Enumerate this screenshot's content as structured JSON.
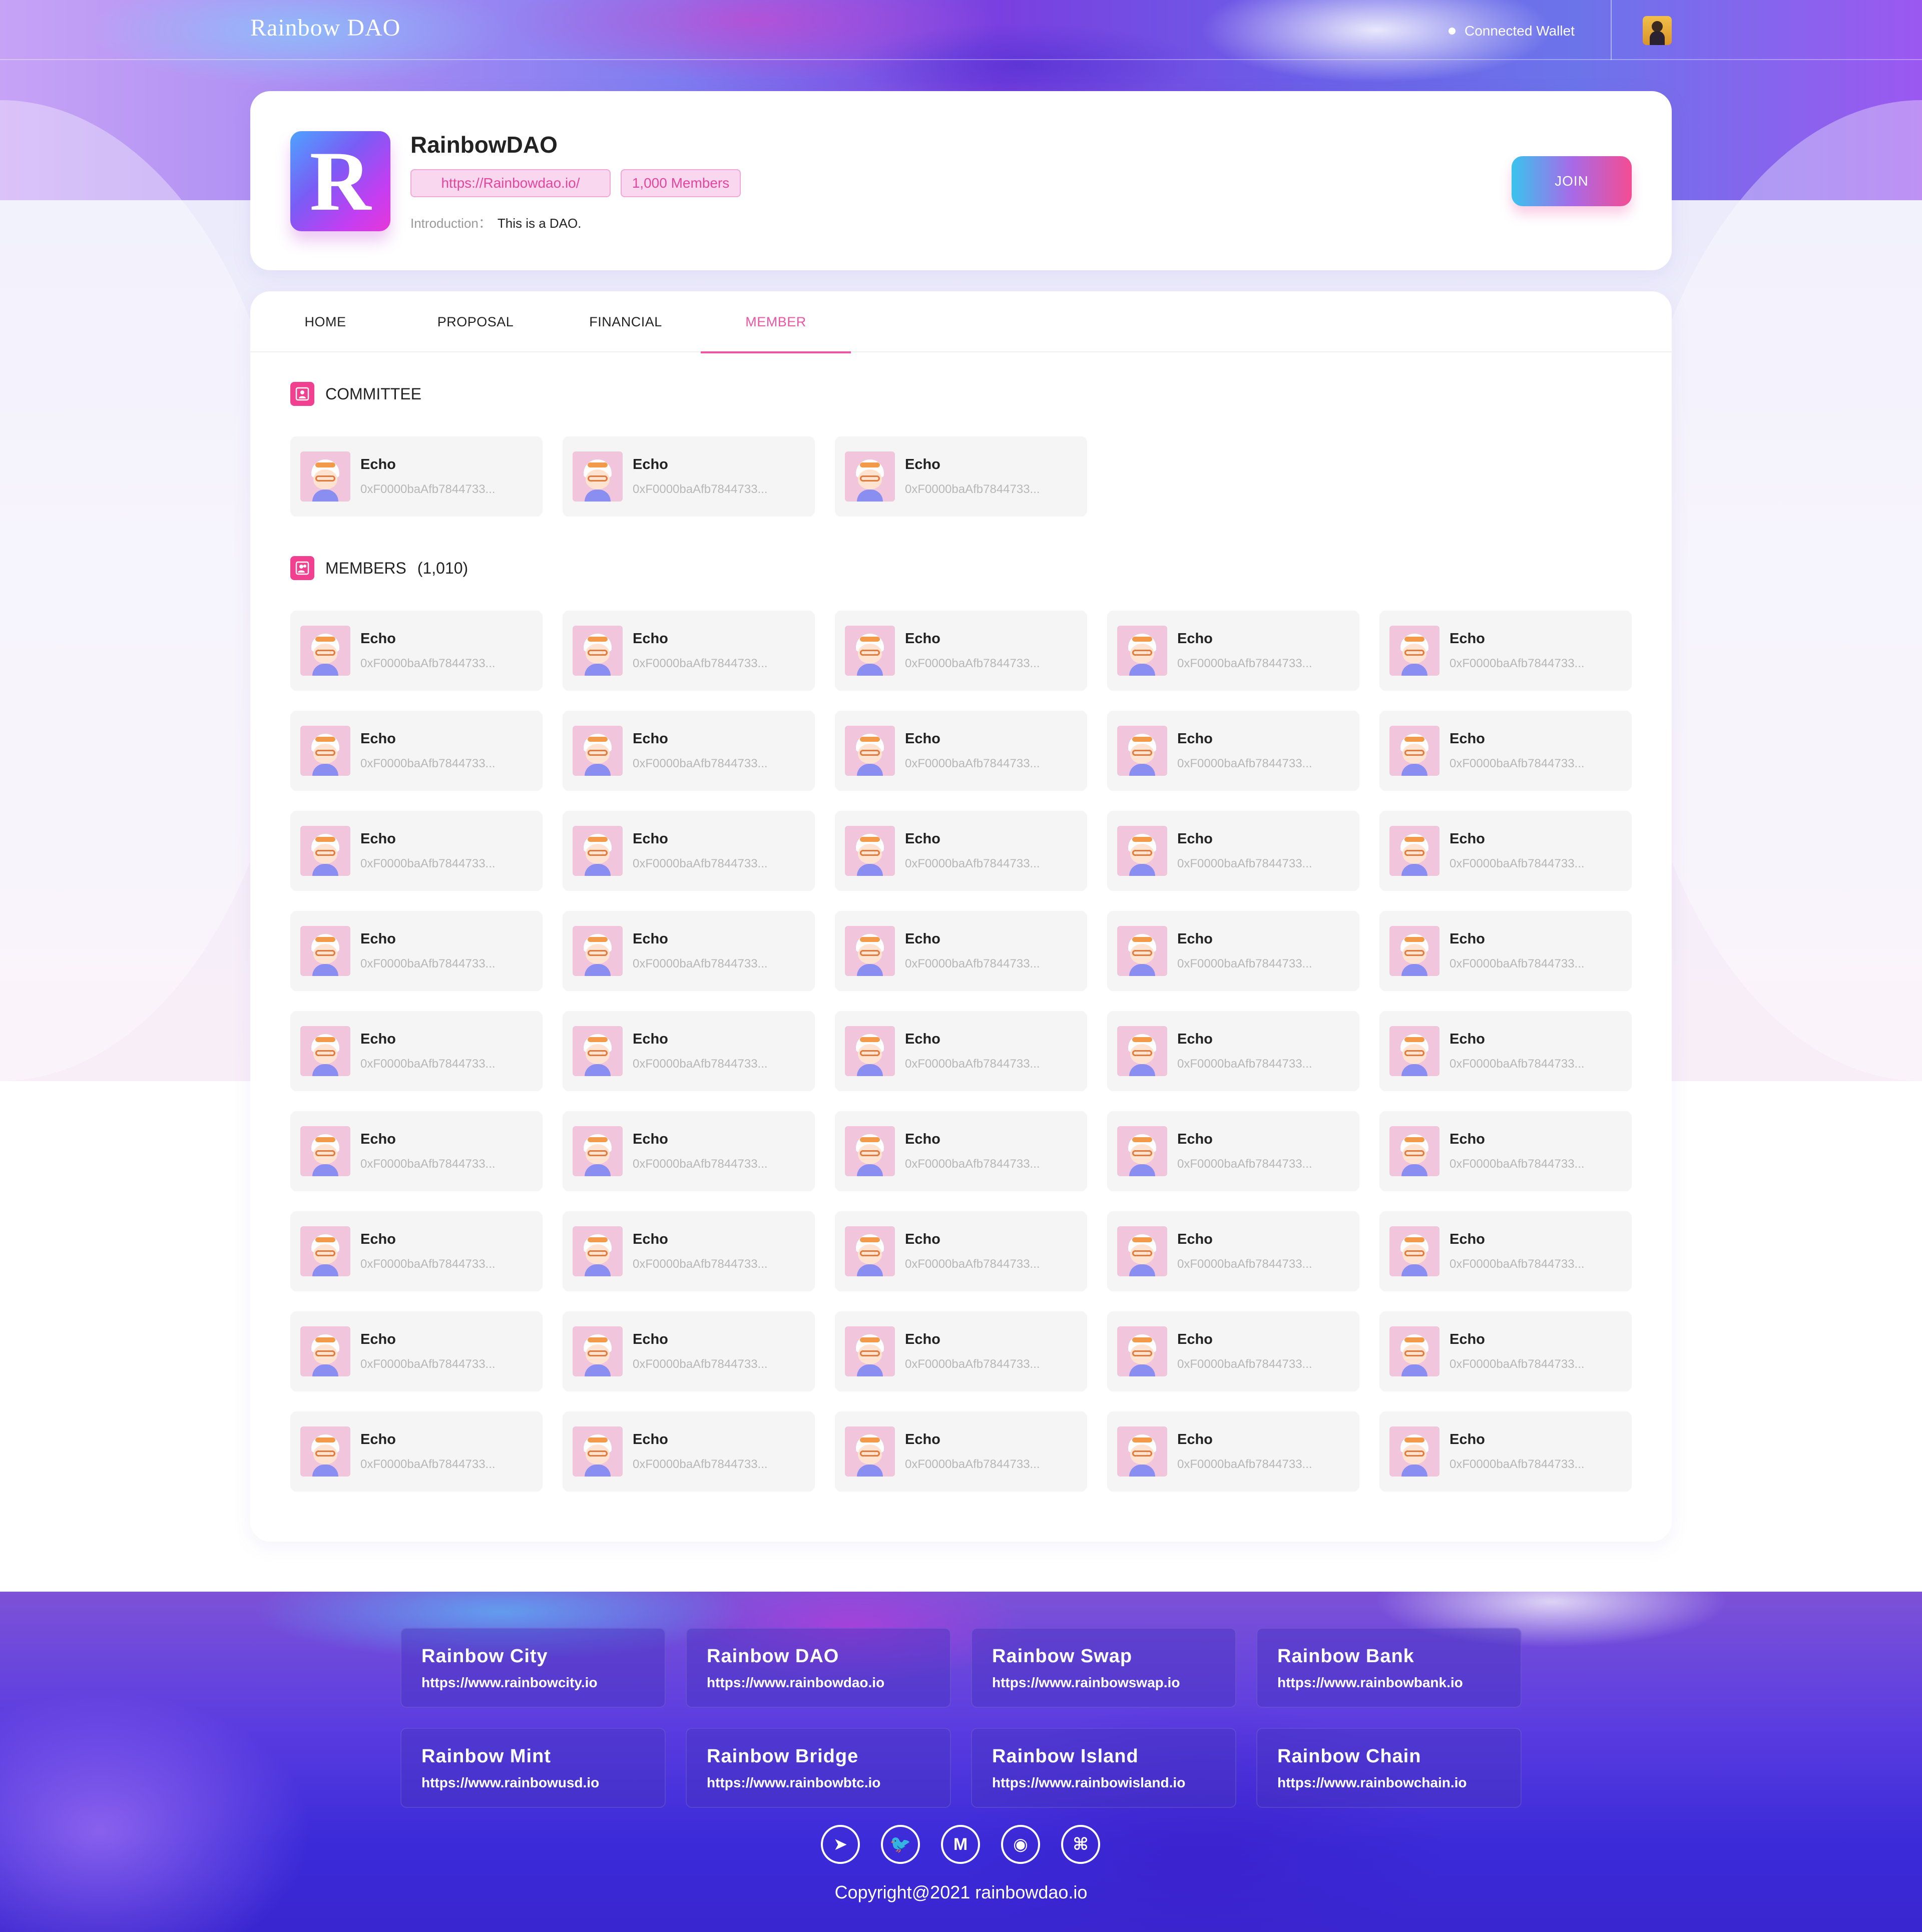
{
  "header": {
    "logo": "Rainbow DAO",
    "wallet_label": "Connected  Wallet",
    "avatar_icon": "user-avatar-icon"
  },
  "profile": {
    "logo_letter": "R",
    "name": "RainbowDAO",
    "url": "https://Rainbowdao.io/",
    "members_count": "1,000 Members",
    "intro_label": "Introduction：",
    "intro_value": "This is a DAO.",
    "join_label": "JOIN"
  },
  "tabs": [
    {
      "label": "HOME",
      "active": false
    },
    {
      "label": "PROPOSAL",
      "active": false
    },
    {
      "label": "FINANCIAL",
      "active": false
    },
    {
      "label": "MEMBER",
      "active": true
    }
  ],
  "committee": {
    "title": "COMMITTEE",
    "icon": "committee-icon",
    "members": [
      {
        "name": "Echo",
        "address": "0xF0000baAfb7844733..."
      },
      {
        "name": "Echo",
        "address": "0xF0000baAfb7844733..."
      },
      {
        "name": "Echo",
        "address": "0xF0000baAfb7844733..."
      }
    ]
  },
  "members": {
    "title": "MEMBERS",
    "count": "(1,010)",
    "icon": "members-icon",
    "list": [
      {
        "name": "Echo",
        "address": "0xF0000baAfb7844733..."
      },
      {
        "name": "Echo",
        "address": "0xF0000baAfb7844733..."
      },
      {
        "name": "Echo",
        "address": "0xF0000baAfb7844733..."
      },
      {
        "name": "Echo",
        "address": "0xF0000baAfb7844733..."
      },
      {
        "name": "Echo",
        "address": "0xF0000baAfb7844733..."
      },
      {
        "name": "Echo",
        "address": "0xF0000baAfb7844733..."
      },
      {
        "name": "Echo",
        "address": "0xF0000baAfb7844733..."
      },
      {
        "name": "Echo",
        "address": "0xF0000baAfb7844733..."
      },
      {
        "name": "Echo",
        "address": "0xF0000baAfb7844733..."
      },
      {
        "name": "Echo",
        "address": "0xF0000baAfb7844733..."
      },
      {
        "name": "Echo",
        "address": "0xF0000baAfb7844733..."
      },
      {
        "name": "Echo",
        "address": "0xF0000baAfb7844733..."
      },
      {
        "name": "Echo",
        "address": "0xF0000baAfb7844733..."
      },
      {
        "name": "Echo",
        "address": "0xF0000baAfb7844733..."
      },
      {
        "name": "Echo",
        "address": "0xF0000baAfb7844733..."
      },
      {
        "name": "Echo",
        "address": "0xF0000baAfb7844733..."
      },
      {
        "name": "Echo",
        "address": "0xF0000baAfb7844733..."
      },
      {
        "name": "Echo",
        "address": "0xF0000baAfb7844733..."
      },
      {
        "name": "Echo",
        "address": "0xF0000baAfb7844733..."
      },
      {
        "name": "Echo",
        "address": "0xF0000baAfb7844733..."
      },
      {
        "name": "Echo",
        "address": "0xF0000baAfb7844733..."
      },
      {
        "name": "Echo",
        "address": "0xF0000baAfb7844733..."
      },
      {
        "name": "Echo",
        "address": "0xF0000baAfb7844733..."
      },
      {
        "name": "Echo",
        "address": "0xF0000baAfb7844733..."
      },
      {
        "name": "Echo",
        "address": "0xF0000baAfb7844733..."
      },
      {
        "name": "Echo",
        "address": "0xF0000baAfb7844733..."
      },
      {
        "name": "Echo",
        "address": "0xF0000baAfb7844733..."
      },
      {
        "name": "Echo",
        "address": "0xF0000baAfb7844733..."
      },
      {
        "name": "Echo",
        "address": "0xF0000baAfb7844733..."
      },
      {
        "name": "Echo",
        "address": "0xF0000baAfb7844733..."
      },
      {
        "name": "Echo",
        "address": "0xF0000baAfb7844733..."
      },
      {
        "name": "Echo",
        "address": "0xF0000baAfb7844733..."
      },
      {
        "name": "Echo",
        "address": "0xF0000baAfb7844733..."
      },
      {
        "name": "Echo",
        "address": "0xF0000baAfb7844733..."
      },
      {
        "name": "Echo",
        "address": "0xF0000baAfb7844733..."
      },
      {
        "name": "Echo",
        "address": "0xF0000baAfb7844733..."
      },
      {
        "name": "Echo",
        "address": "0xF0000baAfb7844733..."
      },
      {
        "name": "Echo",
        "address": "0xF0000baAfb7844733..."
      },
      {
        "name": "Echo",
        "address": "0xF0000baAfb7844733..."
      },
      {
        "name": "Echo",
        "address": "0xF0000baAfb7844733..."
      },
      {
        "name": "Echo",
        "address": "0xF0000baAfb7844733..."
      },
      {
        "name": "Echo",
        "address": "0xF0000baAfb7844733..."
      },
      {
        "name": "Echo",
        "address": "0xF0000baAfb7844733..."
      },
      {
        "name": "Echo",
        "address": "0xF0000baAfb7844733..."
      },
      {
        "name": "Echo",
        "address": "0xF0000baAfb7844733..."
      }
    ]
  },
  "footer": {
    "links": [
      {
        "title": "Rainbow City",
        "url": "https://www.rainbowcity.io"
      },
      {
        "title": "Rainbow DAO",
        "url": "https://www.rainbowdao.io"
      },
      {
        "title": "Rainbow Swap",
        "url": "https://www.rainbowswap.io"
      },
      {
        "title": "Rainbow Bank",
        "url": "https://www.rainbowbank.io"
      },
      {
        "title": "Rainbow Mint",
        "url": "https://www.rainbowusd.io"
      },
      {
        "title": "Rainbow Bridge",
        "url": "https://www.rainbowbtc.io"
      },
      {
        "title": "Rainbow Island",
        "url": "https://www.rainbowisland.io"
      },
      {
        "title": "Rainbow Chain",
        "url": "https://www.rainbowchain.io"
      }
    ],
    "socials": [
      {
        "icon": "telegram-icon",
        "glyph": "➤"
      },
      {
        "icon": "twitter-icon",
        "glyph": "🐦"
      },
      {
        "icon": "medium-icon",
        "glyph": "M"
      },
      {
        "icon": "discord-icon",
        "glyph": "◉"
      },
      {
        "icon": "github-icon",
        "glyph": "⌘"
      }
    ],
    "copyright": "Copyright@2021 rainbowdao.io"
  }
}
